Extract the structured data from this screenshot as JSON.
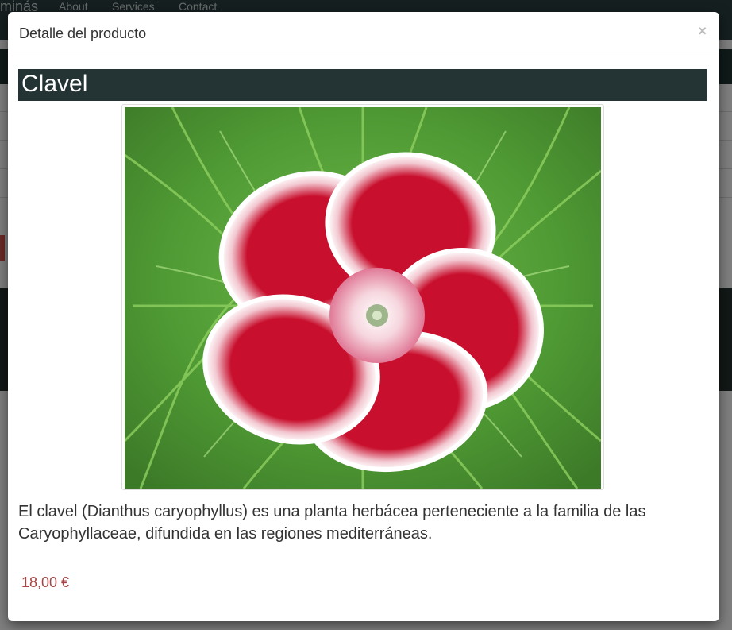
{
  "background": {
    "brand": "minás",
    "nav": [
      "About",
      "Services",
      "Contact"
    ],
    "colors": {
      "navbar": "#2b3e3e",
      "footer": "#24302f"
    }
  },
  "modal": {
    "title": "Detalle del producto",
    "close_label": "×"
  },
  "product": {
    "name": "Clavel",
    "image_icon": "carnation-flower-photo",
    "description": "El clavel (Dianthus caryophyllus) es una planta herbácea perteneciente a la familia de las Caryophyllaceae, difundida en las regiones mediterráneas.",
    "price": "18,00 €"
  },
  "colors": {
    "title_bar": "#243333",
    "price": "#a94442",
    "petal": "#c8102e"
  }
}
